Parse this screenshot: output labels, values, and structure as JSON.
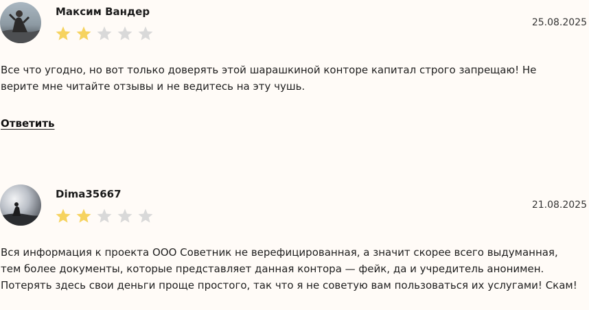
{
  "reviews": [
    {
      "author": "Максим Вандер",
      "date": "25.08.2025",
      "rating": 2,
      "max_rating": 5,
      "text": "Все что угодно, но вот только доверять этой шарашкиной конторе капитал строго запрещаю! Не верите мне читайте отзывы и не ведитесь на эту чушь.",
      "reply_label": "Ответить"
    },
    {
      "author": "Dima35667",
      "date": "21.08.2025",
      "rating": 2,
      "max_rating": 5,
      "text": "Вся информация к проекта ООО Советник не верефицированная, а значит скорее всего выдуманная, тем более документы, которые представляет данная контора — фейк, да и учредитель анонимен. Потерять здесь свои деньги проще простого, так что я не советую вам пользоваться их услугами! Скам!"
    }
  ],
  "colors": {
    "star_filled": "#f6d35f",
    "star_empty": "#d9d9d9",
    "background": "#fffbf7"
  }
}
